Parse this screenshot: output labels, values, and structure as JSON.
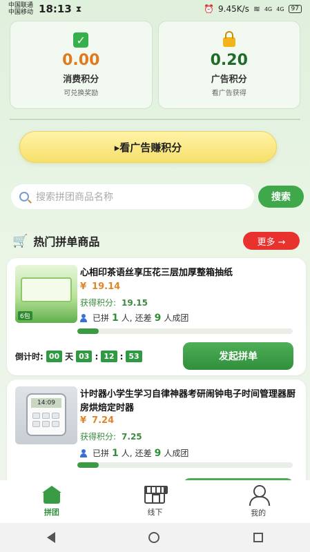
{
  "status_bar": {
    "carrier_1": "中国联通",
    "carrier_2": "中国移动",
    "time": "18:13",
    "network_speed": "9.45K/s",
    "signal_1": "4G",
    "signal_2": "4G",
    "battery": "97"
  },
  "points": {
    "consume": {
      "value": "0.00",
      "title": "消费积分",
      "subtitle": "可兑换奖励",
      "icon": "check-icon",
      "color": "#e07a1f"
    },
    "ad": {
      "value": "0.20",
      "title": "广告积分",
      "subtitle": "看广告获得",
      "icon": "lock-icon",
      "color": "#1e6b2a"
    }
  },
  "ad_button": {
    "label": "▸看广告赚积分"
  },
  "search": {
    "placeholder": "搜索拼团商品名称",
    "button": "搜索"
  },
  "section": {
    "title": "热门拼单商品",
    "more": "更多 →"
  },
  "products": [
    {
      "title": "心相印茶语丝享压花三层加厚整箱抽纸",
      "price_symbol": "¥",
      "price": "19.14",
      "points_label": "获得积分:",
      "points_value": "19.15",
      "joined_prefix": "已拼",
      "joined": "1",
      "joined_unit": "人,",
      "remain_prefix": "还差",
      "remain": "9",
      "remain_suffix": "人成团",
      "progress": 0.1,
      "countdown_label": "倒计时:",
      "countdown_days": "00",
      "countdown_day_unit": "天",
      "countdown_h": "03",
      "countdown_m": "12",
      "countdown_s": "53",
      "button": "发起拼单",
      "thumb_badge": "6包"
    },
    {
      "title": "计时器小学生学习自律神器考研闹钟电子时间管理器厨房烘焙定时器",
      "price_symbol": "¥",
      "price": "7.24",
      "points_label": "获得积分:",
      "points_value": "7.25",
      "joined_prefix": "已拼",
      "joined": "1",
      "joined_unit": "人,",
      "remain_prefix": "还差",
      "remain": "9",
      "remain_suffix": "人成团",
      "progress": 0.1,
      "thumb_screen": "14:09"
    }
  ],
  "tabs": [
    {
      "label": "拼团",
      "icon": "home-icon",
      "active": true
    },
    {
      "label": "线下",
      "icon": "store-icon",
      "active": false
    },
    {
      "label": "我的",
      "icon": "user-icon",
      "active": false
    }
  ]
}
